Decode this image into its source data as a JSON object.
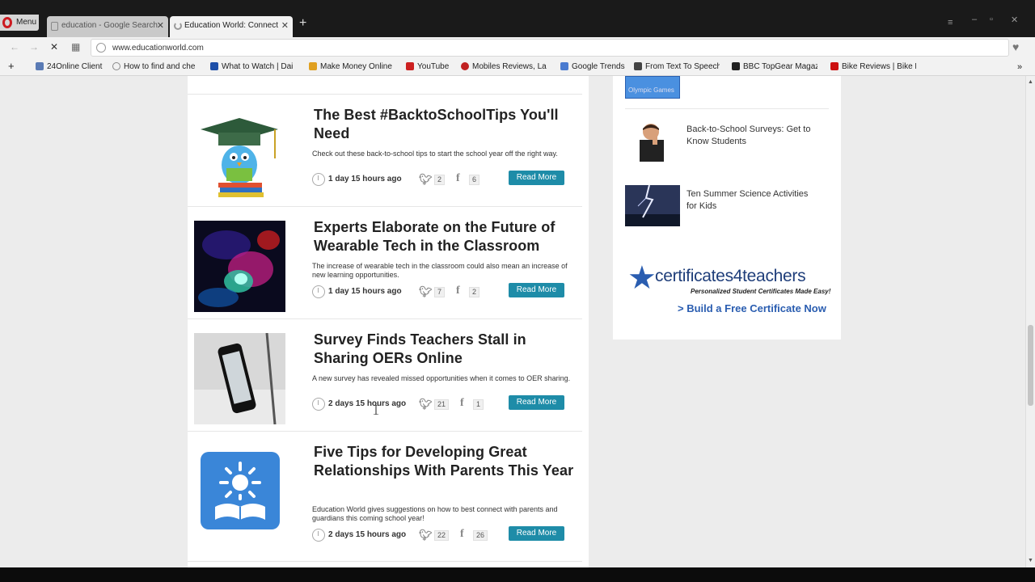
{
  "browser": {
    "menu_label": "Menu",
    "tabs": [
      {
        "title": "education - Google Search",
        "active": false
      },
      {
        "title": "Education World: Connect",
        "active": true
      }
    ],
    "url": "www.educationworld.com",
    "bookmarks": [
      {
        "label": "24Online Client",
        "color": "#5a7bb5"
      },
      {
        "label": "How to find and che",
        "color": "#888888"
      },
      {
        "label": "What to Watch | Dai",
        "color": "#1d4fa8"
      },
      {
        "label": "Make Money Online",
        "color": "#e0a020"
      },
      {
        "label": "YouTube",
        "color": "#cc2020"
      },
      {
        "label": "Mobiles Reviews, La",
        "color": "#c02020"
      },
      {
        "label": "Google Trends",
        "color": "#4a7bd0"
      },
      {
        "label": "From Text To Speech",
        "color": "#444444"
      },
      {
        "label": "BBC TopGear Magaz",
        "color": "#222222"
      },
      {
        "label": "Bike Reviews | Bike R",
        "color": "#cc1010"
      }
    ]
  },
  "articles": [
    {
      "title": "The Best #BacktoSchoolTips You'll Need",
      "description": "Check out these back-to-school tips to start the school year off the right way.",
      "time_ago": "1 day 15 hours ago",
      "twitter_count": "2",
      "facebook_count": "6",
      "read_more_label": "Read More",
      "image": "graduation-bird-on-books"
    },
    {
      "title": "Experts Elaborate on the Future of Wearable Tech in the Classroom",
      "description": "The increase of wearable tech in the classroom could also mean an increase of new learning opportunities.",
      "time_ago": "1 day 15 hours ago",
      "twitter_count": "7",
      "facebook_count": "2",
      "read_more_label": "Read More",
      "image": "glowing-wearable-device"
    },
    {
      "title": "Survey Finds Teachers Stall in Sharing OERs Online",
      "description": "A new survey has revealed missed opportunities when it comes to OER sharing.",
      "time_ago": "2 days 15 hours ago",
      "twitter_count": "21",
      "facebook_count": "1",
      "read_more_label": "Read More",
      "image": "smartphone-on-notebook"
    },
    {
      "title": "Five Tips for Developing Great Relationships With Parents This Year",
      "description": "Education World gives suggestions on how to best connect with parents and guardians this coming school year!",
      "time_ago": "2 days 15 hours ago",
      "twitter_count": "22",
      "facebook_count": "26",
      "read_more_label": "Read More",
      "image": "sun-over-open-book"
    }
  ],
  "sidebar": {
    "top_image_caption": "Olympic Games",
    "items": [
      {
        "title": "Back-to-School Surveys: Get to Know Students"
      },
      {
        "title": "Ten Summer Science Activities for Kids"
      }
    ],
    "ad": {
      "brand": "certificates4teachers",
      "tagline": "Personalized Student Certificates Made Easy!",
      "cta": "> Build a Free Certificate Now"
    }
  },
  "colors": {
    "read_more_bg": "#1e8ca8",
    "title_text": "#222222",
    "page_bg": "#ececec",
    "cert_blue": "#2a5db0"
  }
}
